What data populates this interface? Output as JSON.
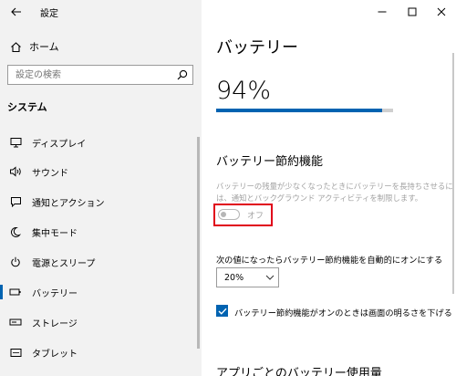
{
  "window": {
    "title": "設定",
    "controls": [
      "minimize",
      "maximize",
      "close"
    ]
  },
  "sidebar": {
    "home_label": "ホーム",
    "search_placeholder": "設定の検索",
    "section_title": "システム",
    "items": [
      {
        "label": "ディスプレイ",
        "icon": "display-icon",
        "active": false
      },
      {
        "label": "サウンド",
        "icon": "speaker-icon",
        "active": false
      },
      {
        "label": "通知とアクション",
        "icon": "notification-icon",
        "active": false
      },
      {
        "label": "集中モード",
        "icon": "moon-icon",
        "active": false
      },
      {
        "label": "電源とスリープ",
        "icon": "power-icon",
        "active": false
      },
      {
        "label": "バッテリー",
        "icon": "battery-icon",
        "active": true
      },
      {
        "label": "ストレージ",
        "icon": "storage-icon",
        "active": false
      },
      {
        "label": "タブレット",
        "icon": "tablet-icon",
        "active": false
      }
    ]
  },
  "main": {
    "title": "バッテリー",
    "percent_text": "94%",
    "percent_value": 94,
    "saver": {
      "heading": "バッテリー節約機能",
      "description": "バッテリーの残量が少なくなったときにバッテリーを長持ちさせるには、通知とバックグラウンド アクティビティを制限します。",
      "toggle_state": "オフ",
      "auto_label": "次の値になったらバッテリー節約機能を自動的にオンにする",
      "auto_value": "20%",
      "brightness_label": "バッテリー節約機能がオンのときは画面の明るさを下げる",
      "brightness_checked": true
    },
    "usage_heading": "アプリごとのバッテリー使用量"
  },
  "colors": {
    "accent": "#0063b1",
    "highlight_box": "#e0001a",
    "sidebar_bg": "#f2f2f2"
  }
}
